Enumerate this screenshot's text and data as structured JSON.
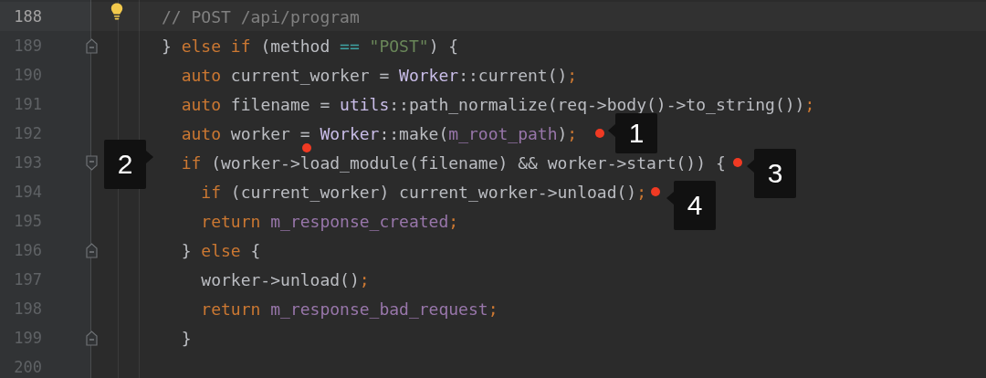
{
  "editor": {
    "lines": [
      {
        "number": "188",
        "current": true,
        "hint": true,
        "tokens": [
          {
            "kind": "comment",
            "t": "// POST /api/program"
          }
        ]
      },
      {
        "number": "189",
        "current": false,
        "fold": {
          "kind": "up"
        },
        "tokens": [
          {
            "kind": "plain",
            "t": "} "
          },
          {
            "kind": "kw",
            "t": "else if"
          },
          {
            "kind": "plain",
            "t": " (method "
          },
          {
            "kind": "op",
            "t": "== "
          },
          {
            "kind": "str",
            "t": "\"POST\""
          },
          {
            "kind": "plain",
            "t": ") {"
          }
        ]
      },
      {
        "number": "190",
        "current": false,
        "tokens": [
          {
            "kind": "kw",
            "t": "  auto"
          },
          {
            "kind": "plain",
            "t": " current_worker = "
          },
          {
            "kind": "type",
            "t": "Worker"
          },
          {
            "kind": "plain",
            "t": "::current()"
          },
          {
            "kind": "semi",
            "t": ";"
          }
        ]
      },
      {
        "number": "191",
        "current": false,
        "tokens": [
          {
            "kind": "kw",
            "t": "  auto"
          },
          {
            "kind": "plain",
            "t": " filename = "
          },
          {
            "kind": "type",
            "t": "utils"
          },
          {
            "kind": "plain",
            "t": "::path_normalize(req->body()->to_string())"
          },
          {
            "kind": "semi",
            "t": ";"
          }
        ]
      },
      {
        "number": "192",
        "current": false,
        "tokens": [
          {
            "kind": "kw",
            "t": "  auto"
          },
          {
            "kind": "plain",
            "t": " worker = "
          },
          {
            "kind": "type",
            "t": "Worker"
          },
          {
            "kind": "plain",
            "t": "::make("
          },
          {
            "kind": "member",
            "t": "m_root_path"
          },
          {
            "kind": "plain",
            "t": ")"
          },
          {
            "kind": "semi",
            "t": ";"
          }
        ]
      },
      {
        "number": "193",
        "current": false,
        "fold": {
          "kind": "down"
        },
        "tokens": [
          {
            "kind": "kw",
            "t": "  if"
          },
          {
            "kind": "plain",
            "t": " (worker->load_module(filename) && worker->start()) {"
          }
        ]
      },
      {
        "number": "194",
        "current": false,
        "tokens": [
          {
            "kind": "kw",
            "t": "    if"
          },
          {
            "kind": "plain",
            "t": " (current_worker) current_worker->unload()"
          },
          {
            "kind": "semi",
            "t": ";"
          }
        ]
      },
      {
        "number": "195",
        "current": false,
        "tokens": [
          {
            "kind": "kw",
            "t": "    return "
          },
          {
            "kind": "member",
            "t": "m_response_created"
          },
          {
            "kind": "semi",
            "t": ";"
          }
        ]
      },
      {
        "number": "196",
        "current": false,
        "fold": {
          "kind": "up"
        },
        "tokens": [
          {
            "kind": "plain",
            "t": "  } "
          },
          {
            "kind": "kw",
            "t": "else"
          },
          {
            "kind": "plain",
            "t": " {"
          }
        ]
      },
      {
        "number": "197",
        "current": false,
        "tokens": [
          {
            "kind": "plain",
            "t": "    worker->unload()"
          },
          {
            "kind": "semi",
            "t": ";"
          }
        ]
      },
      {
        "number": "198",
        "current": false,
        "tokens": [
          {
            "kind": "kw",
            "t": "    return "
          },
          {
            "kind": "member",
            "t": "m_response_bad_request"
          },
          {
            "kind": "semi",
            "t": ";"
          }
        ]
      },
      {
        "number": "199",
        "current": false,
        "fold": {
          "kind": "up"
        },
        "tokens": [
          {
            "kind": "plain",
            "t": "  }"
          }
        ]
      },
      {
        "number": "200",
        "current": false
      }
    ]
  },
  "markers": [
    {
      "label": "1",
      "kind": "left"
    },
    {
      "label": "2",
      "kind": "right"
    },
    {
      "label": "3",
      "kind": "left"
    },
    {
      "label": "4",
      "kind": "left"
    }
  ]
}
